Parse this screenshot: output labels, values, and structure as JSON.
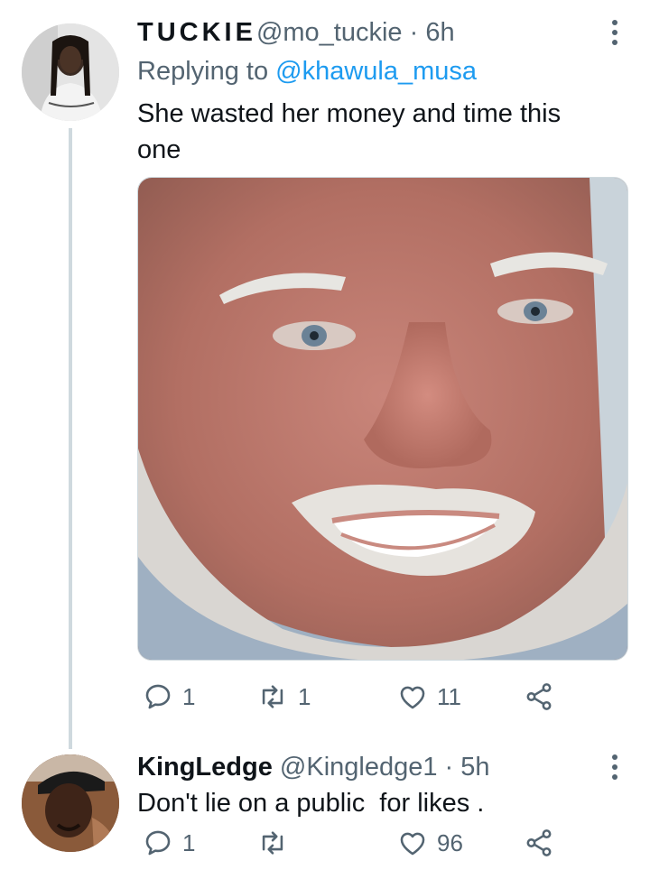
{
  "tweets": [
    {
      "name": "TUCKIE",
      "handle": "@mo_tuckie",
      "separator": " · ",
      "time": "6h",
      "replying_prefix": "Replying to ",
      "replying_handle": "@khawula_musa",
      "text": "She wasted her money and time this one",
      "avatar_icon": "user-avatar-photo",
      "media_icon": "face-photo",
      "stats": {
        "replies": "1",
        "retweets": "1",
        "likes": "11"
      }
    },
    {
      "name": "KingLedge",
      "handle": "@Kingledge1",
      "separator": " · ",
      "time": "5h",
      "text": "Don't lie on a public  for likes .",
      "avatar_icon": "user-avatar-photo",
      "stats": {
        "replies": "1",
        "retweets": "",
        "likes": "96"
      }
    }
  ],
  "colors": {
    "text": "#0f1419",
    "secondary": "#536471",
    "link": "#1d9bf0",
    "thread_line": "#cfd9de"
  },
  "icons": [
    "reply-icon",
    "retweet-icon",
    "like-icon",
    "share-icon",
    "more-icon"
  ]
}
